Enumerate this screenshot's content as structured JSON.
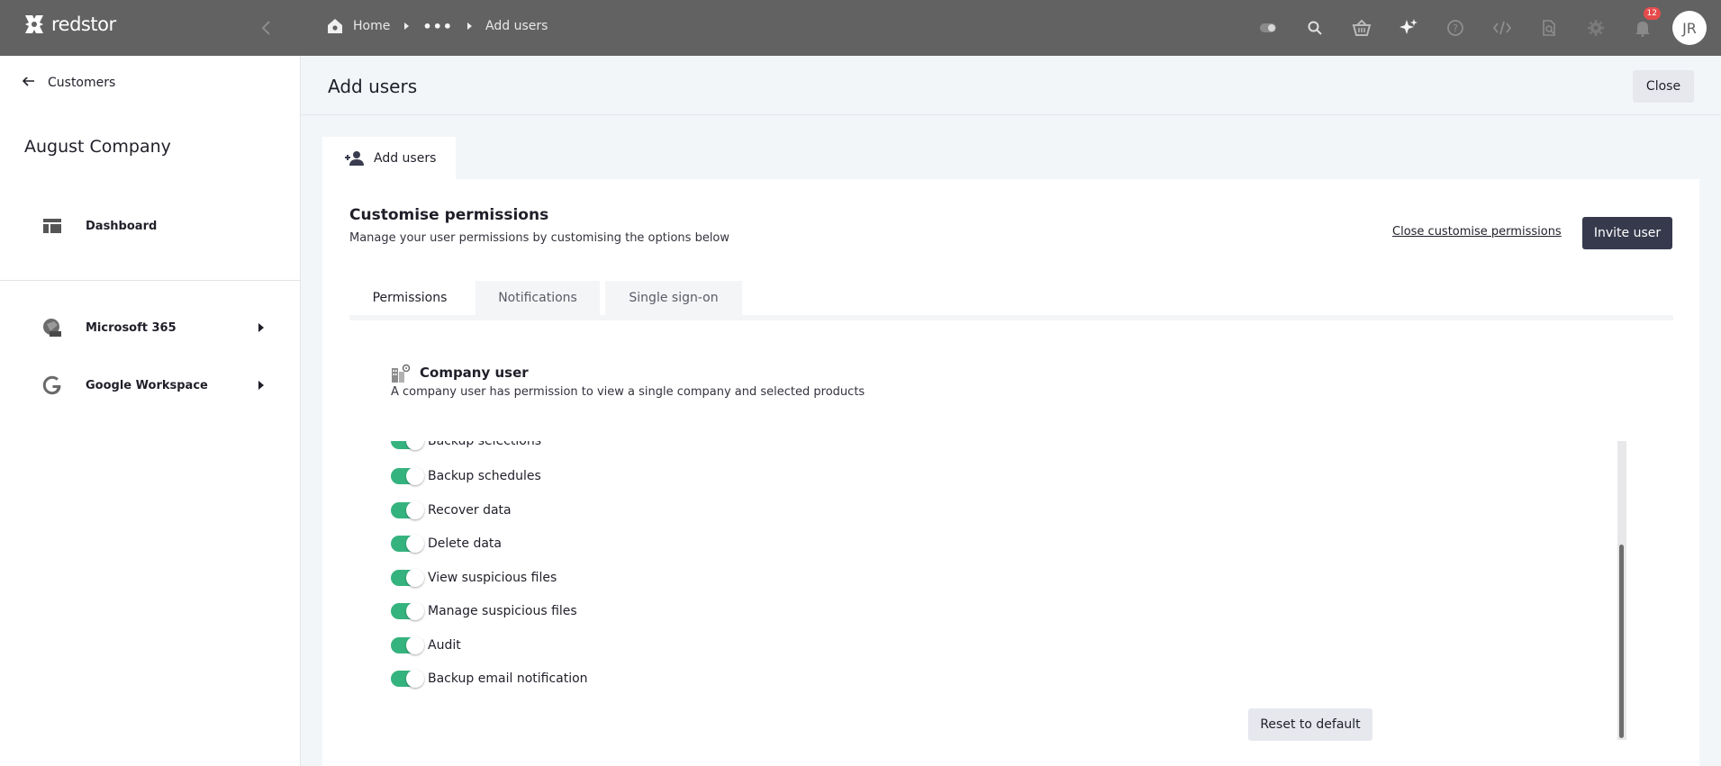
{
  "app": {
    "brand": "redstor"
  },
  "topbar": {
    "breadcrumb": {
      "home": "Home",
      "ellipsis": "•••",
      "current": "Add users"
    },
    "icons": [
      "toggle-icon",
      "search-icon",
      "basket-icon",
      "sparkle-icon",
      "help-icon",
      "code-icon",
      "document-search-icon",
      "gear-icon",
      "bell-icon"
    ],
    "notification_count": "12",
    "avatar_initials": "JR"
  },
  "sidebar": {
    "back_label": "Customers",
    "company_name": "August Company",
    "items": [
      {
        "label": "Dashboard",
        "icon": "dashboard-icon"
      },
      {
        "label": "Microsoft 365",
        "icon": "microsoft-365-icon"
      },
      {
        "label": "Google Workspace",
        "icon": "google-icon"
      }
    ]
  },
  "header": {
    "title": "Add users",
    "close_label": "Close"
  },
  "outer_tab": {
    "label": "Add users"
  },
  "panel": {
    "title": "Customise permissions",
    "subtitle": "Manage your user permissions by customising the options below",
    "close_permissions_label": "Close customise permissions",
    "invite_label": "Invite user",
    "tabs": [
      {
        "label": "Permissions",
        "active": true
      },
      {
        "label": "Notifications",
        "active": false
      },
      {
        "label": "Single sign-on",
        "active": false
      }
    ],
    "role": {
      "title": "Company user",
      "description": "A company user has permission to view a single company and selected products"
    },
    "permissions": [
      {
        "label": "Backup selections",
        "enabled": true
      },
      {
        "label": "Backup schedules",
        "enabled": true
      },
      {
        "label": "Recover data",
        "enabled": true
      },
      {
        "label": "Delete data",
        "enabled": true
      },
      {
        "label": "View suspicious files",
        "enabled": true
      },
      {
        "label": "Manage suspicious files",
        "enabled": true
      },
      {
        "label": "Audit",
        "enabled": true
      },
      {
        "label": "Backup email notification",
        "enabled": true
      }
    ],
    "reset_label": "Reset to default"
  },
  "colors": {
    "topbar": "#626262",
    "toggle_on": "#35b37e",
    "primary_button": "#373a4d",
    "badge": "#e64b4b"
  }
}
